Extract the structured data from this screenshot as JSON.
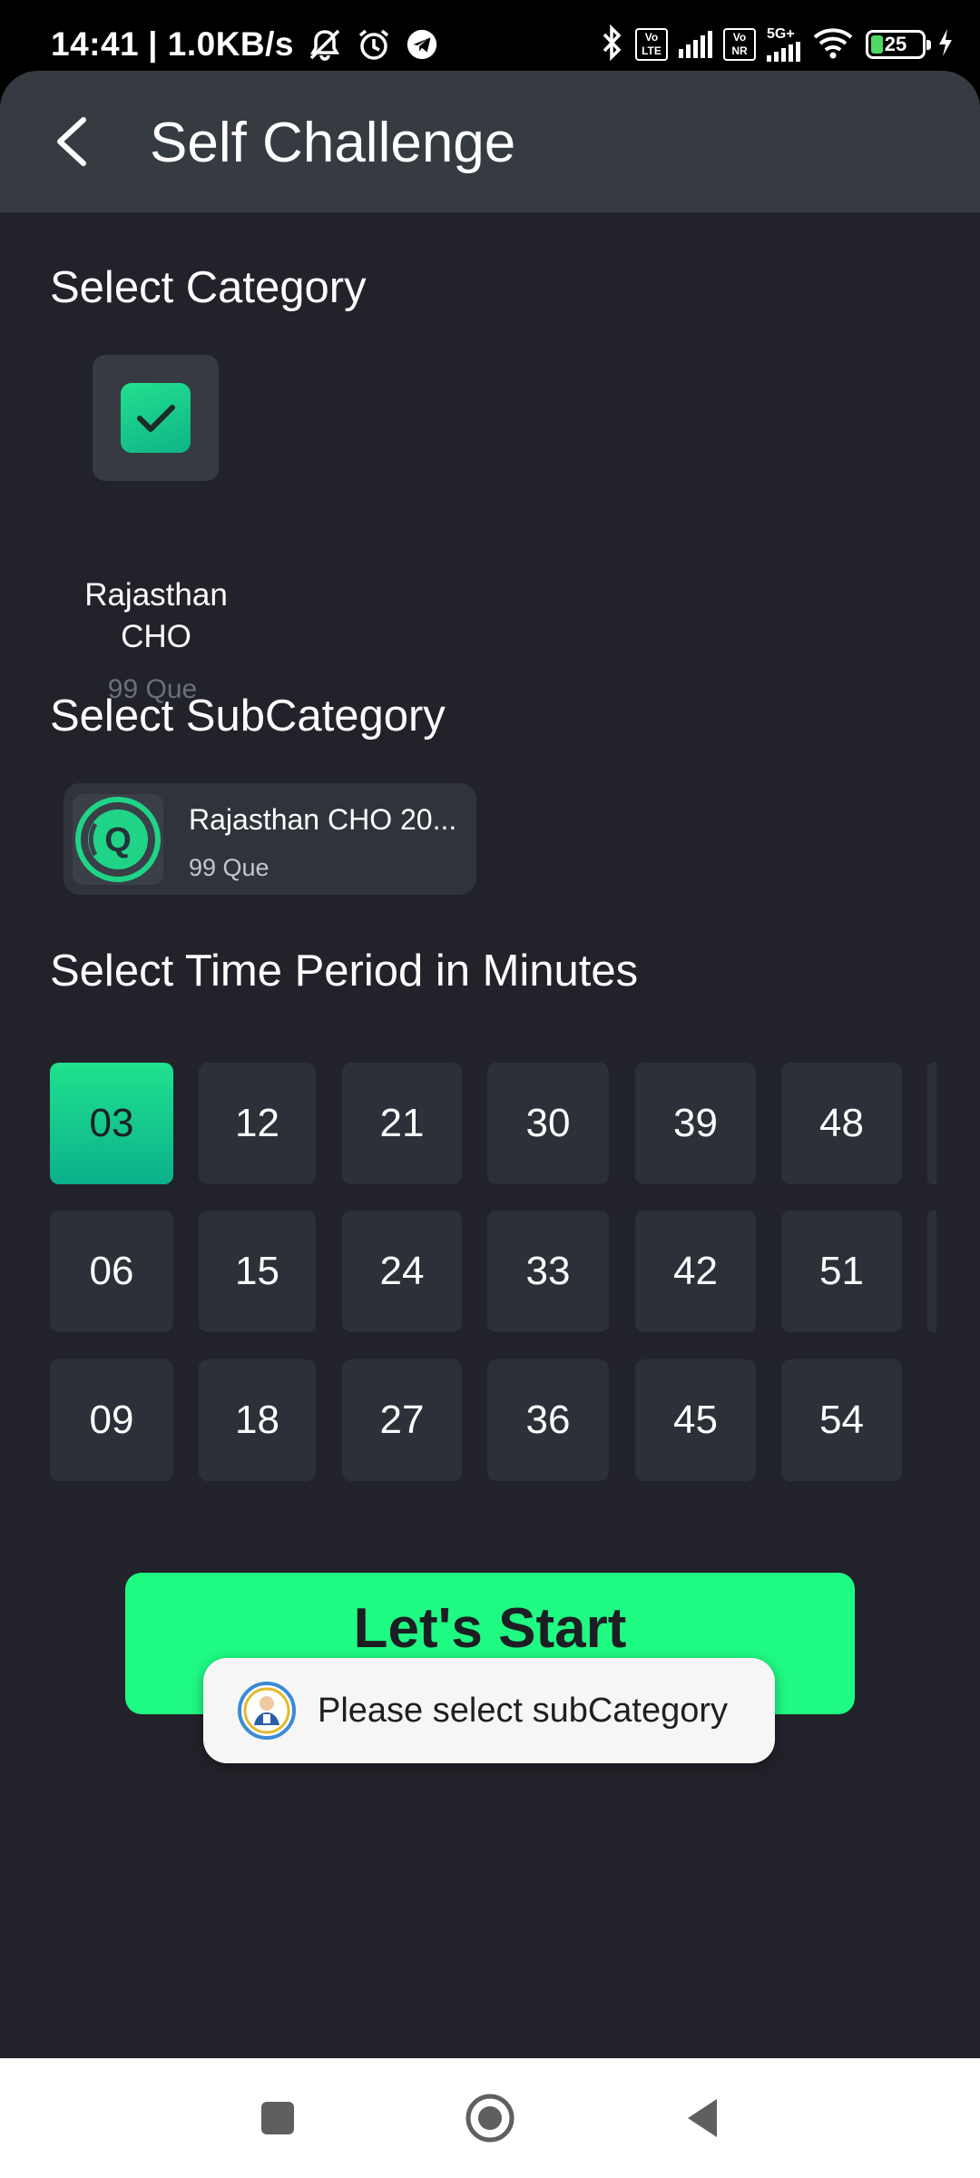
{
  "status": {
    "time": "14:41",
    "speed": "| 1.0KB/s",
    "network_5g": "5G+",
    "volte1": "Vo LTE",
    "volte2": "Vo NR",
    "battery": "25",
    "battery_level": 0.25
  },
  "header": {
    "title": "Self Challenge",
    "back_icon": "back-arrow-icon"
  },
  "category": {
    "section_title": "Select Category",
    "items": [
      {
        "name": "Rajasthan CHO",
        "count": "99 Que",
        "selected": true
      }
    ]
  },
  "subcategory": {
    "section_title": "Select SubCategory",
    "items": [
      {
        "name": "Rajasthan CHO 20...",
        "count": "99 Que"
      }
    ]
  },
  "time_period": {
    "section_title": "Select Time Period in Minutes",
    "options": [
      "03",
      "06",
      "09",
      "12",
      "15",
      "18",
      "21",
      "24",
      "27",
      "30",
      "33",
      "36",
      "39",
      "42",
      "45",
      "48",
      "51",
      "54"
    ],
    "selected": "03"
  },
  "start_button": {
    "label": "Let's Start"
  },
  "toast": {
    "message": "Please select subCategory"
  },
  "colors": {
    "accent": "#1ffa83",
    "selected_gradient_top": "#20e28e",
    "background": "#22232a",
    "app_bar": "#363a41"
  }
}
